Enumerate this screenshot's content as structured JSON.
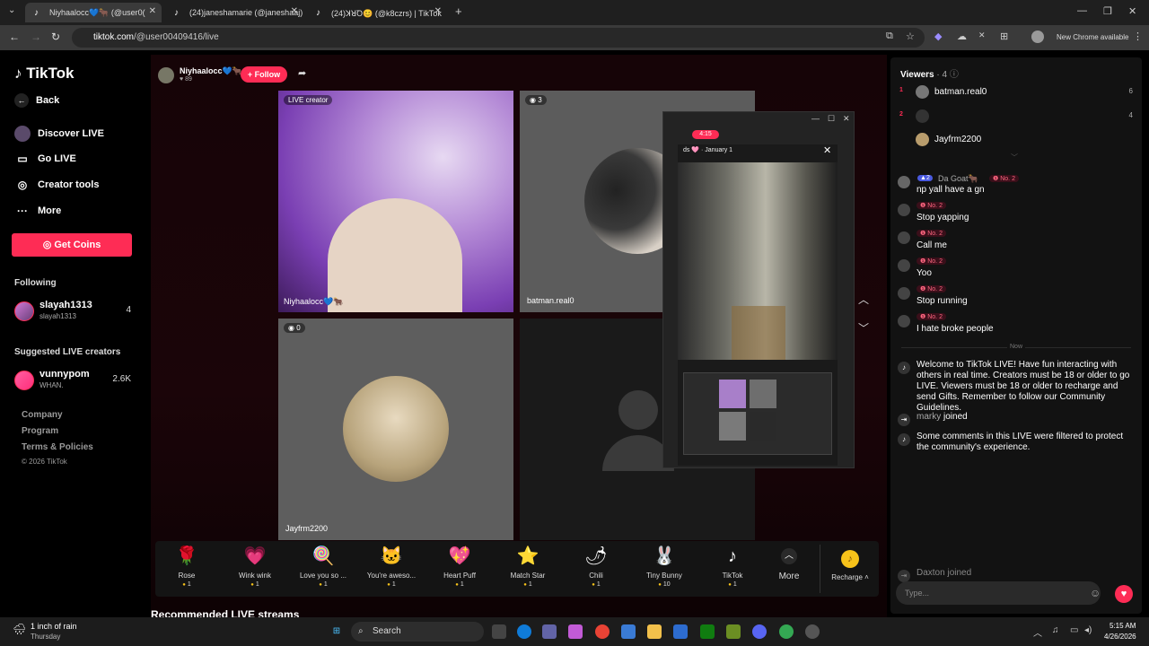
{
  "browser": {
    "tabs": [
      {
        "title": "Niyhaalocc💙🐂 (@user0(",
        "active": true
      },
      {
        "title": "(24)janeshamarie (@janeshaaj)",
        "active": false
      },
      {
        "title": "(24)ꓘꓤꝹ😊 (@k8czrs) | TikTok",
        "active": false
      }
    ],
    "url_host": "tiktok.com",
    "url_path": "/@user00409416/live",
    "new_chrome": "New Chrome available"
  },
  "nav": {
    "logo": "TikTok",
    "back": "Back",
    "items": [
      "Discover LIVE",
      "Go LIVE",
      "Creator tools",
      "More"
    ],
    "get_coins": "Get Coins",
    "following_title": "Following",
    "following": [
      {
        "name": "slayah1313",
        "handle": "slayah1313",
        "count": "4"
      }
    ],
    "suggested_title": "Suggested LIVE creators",
    "suggested": [
      {
        "name": "vunnypom",
        "handle": "WHAN.",
        "count": "2.6K"
      }
    ],
    "footer": [
      "Company",
      "Program",
      "Terms & Policies",
      "© 2026 TikTok"
    ]
  },
  "stage": {
    "host_name": "Niyhaalocc💙🐂",
    "host_likes": "89",
    "follow": "+ Follow",
    "tiles": [
      {
        "label": "Niyhaalocc💙🐂",
        "badge": "LIVE creator"
      },
      {
        "label": "batman.real0",
        "badge": "3"
      },
      {
        "label": "Jayfrm2200",
        "badge": "0"
      }
    ],
    "popup_time": "4:15",
    "popup_date": "January 1",
    "popup_name": "ds 🩷"
  },
  "gifts": [
    {
      "name": "Rose",
      "price": "1",
      "icon": "🌹"
    },
    {
      "name": "Wink wink",
      "price": "1",
      "icon": "💗"
    },
    {
      "name": "Love you so ...",
      "price": "1",
      "icon": "🍭"
    },
    {
      "name": "You're aweso...",
      "price": "1",
      "icon": "🐱"
    },
    {
      "name": "Heart Puff",
      "price": "1",
      "icon": "💖"
    },
    {
      "name": "Match Star",
      "price": "1",
      "icon": "⭐"
    },
    {
      "name": "Chili",
      "price": "1",
      "icon": "🌶"
    },
    {
      "name": "Tiny Bunny",
      "price": "10",
      "icon": "🐰"
    },
    {
      "name": "TikTok",
      "price": "1",
      "icon": "♪"
    }
  ],
  "gift_more": "More",
  "recharge": "Recharge",
  "recommended_title": "Recommended LIVE streams",
  "chat": {
    "viewers_title": "Viewers",
    "viewers_count": "· 4",
    "viewers": [
      {
        "rank": "1",
        "name": "batman.real0",
        "count": "6"
      },
      {
        "rank": "2",
        "name": "",
        "count": "4"
      },
      {
        "rank": "",
        "name": "Jayfrm2200",
        "count": ""
      }
    ],
    "messages": [
      {
        "user": "Da Goat🐂",
        "badge": "No. 2",
        "text": "np yall have a gn",
        "level": "2"
      },
      {
        "badge": "No. 2",
        "text": "Stop yapping"
      },
      {
        "badge": "No. 2",
        "text": "Call me"
      },
      {
        "badge": "No. 2",
        "text": "Yoo"
      },
      {
        "badge": "No. 2",
        "text": "Stop running"
      },
      {
        "badge": "No. 2",
        "text": "I hate broke people"
      }
    ],
    "now": "Now",
    "welcome": "Welcome to TikTok LIVE! Have fun interacting with others in real time. Creators must be 18 or older to go LIVE. Viewers must be 18 or older to recharge and send Gifts. Remember to follow our Community Guidelines.",
    "joined_user": "marky",
    "joined": "joined",
    "filtered": "Some comments in this LIVE were filtered to protect the community's experience.",
    "joined_user2": "Daxton",
    "input_placeholder": "Type..."
  },
  "taskbar": {
    "weather": "1 inch of rain",
    "weather_day": "Thursday",
    "search": "Search",
    "time": "5:15 AM",
    "date": "4/26/2026"
  }
}
